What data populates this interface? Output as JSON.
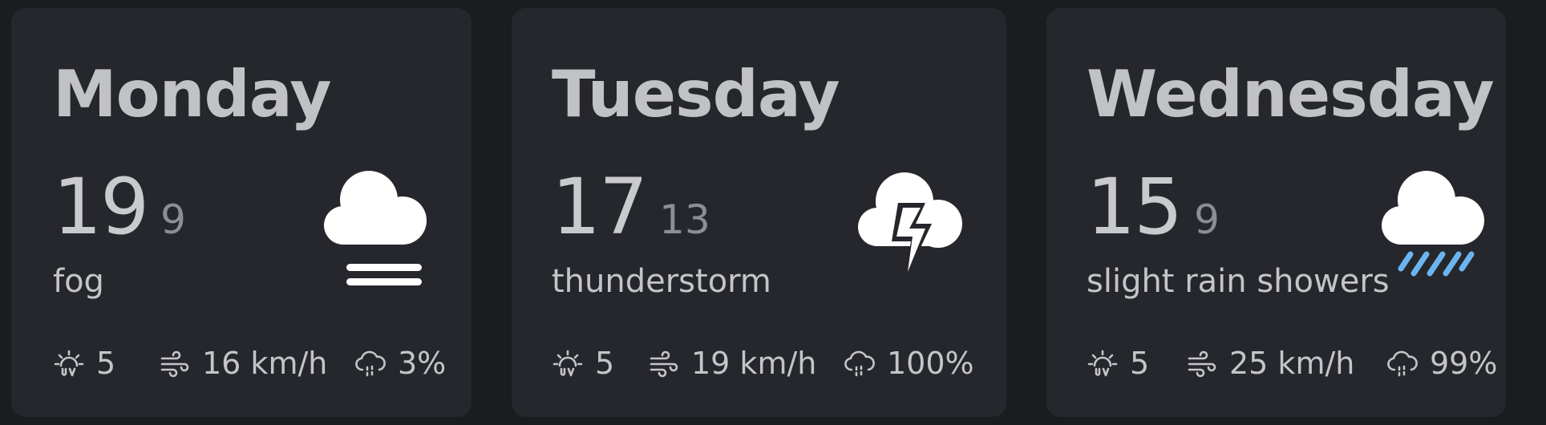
{
  "days": [
    {
      "name": "Monday",
      "high": "19",
      "low": "9",
      "condition": "fog",
      "icon": "fog-icon",
      "uv": "5",
      "wind": "16 km/h",
      "precip": "3%"
    },
    {
      "name": "Tuesday",
      "high": "17",
      "low": "13",
      "condition": "thunderstorm",
      "icon": "thunderstorm-icon",
      "uv": "5",
      "wind": "19 km/h",
      "precip": "100%"
    },
    {
      "name": "Wednesday",
      "high": "15",
      "low": "9",
      "condition": "slight rain showers",
      "icon": "rain-showers-icon",
      "uv": "5",
      "wind": "25 km/h",
      "precip": "99%"
    }
  ],
  "colors": {
    "background": "#1b1c20",
    "card": "#26272c",
    "rain_accent": "#6cb4f0"
  }
}
